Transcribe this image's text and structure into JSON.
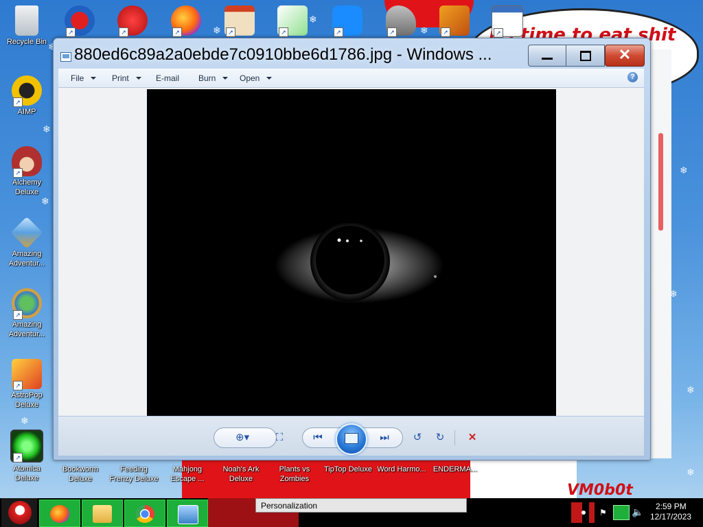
{
  "desktop": {
    "left_icons": [
      {
        "label": "Recycle Bin",
        "icon": "recycle-bin-icon",
        "color": "#d8dde4"
      },
      {
        "label": "AIMP",
        "icon": "aimp-icon",
        "color": "#f2c200"
      },
      {
        "label": "Alchemy Deluxe",
        "icon": "wizard-icon",
        "color": "#b03030"
      },
      {
        "label": "Amazing Adventur...",
        "icon": "gem-icon",
        "color": "#5aa0e0"
      },
      {
        "label": "Amazing Adventur...",
        "icon": "globe-icon",
        "color": "#3a9a3a"
      },
      {
        "label": "AstroPop Deluxe",
        "icon": "astropop-icon",
        "color": "#e04020"
      },
      {
        "label": "Atomica Deluxe",
        "icon": "radiation-icon",
        "color": "#20c020"
      }
    ],
    "bottom_icons": [
      {
        "label": "Bookworm Deluxe"
      },
      {
        "label": "Feeding Frenzy Deluxe"
      },
      {
        "label": "Mahjong Escape ..."
      },
      {
        "label": "Noah's Ark Deluxe"
      },
      {
        "label": "Plants vs Zombies"
      },
      {
        "label": "TipTop Deluxe"
      },
      {
        "label": "Word Harmo..."
      },
      {
        "label": "ENDERMA..."
      }
    ],
    "wallpaper_text": {
      "top": "its time to eat shit",
      "bottom": "VM0b0t"
    }
  },
  "window": {
    "title": "880ed6c89a2a0ebde7c0910bbe6d1786.jpg - Windows ...",
    "menu": [
      {
        "label": "File",
        "has_dropdown": true
      },
      {
        "label": "Print",
        "has_dropdown": true
      },
      {
        "label": "E-mail",
        "has_dropdown": false
      },
      {
        "label": "Burn",
        "has_dropdown": true
      },
      {
        "label": "Open",
        "has_dropdown": true
      }
    ],
    "help_glyph": "?",
    "close_glyph": "✕"
  },
  "controls": {
    "zoom": "zoom-icon",
    "actual_size": "actual-size-icon",
    "previous": "previous-icon",
    "slideshow": "slideshow-icon",
    "next": "next-icon",
    "rotate_ccw": "rotate-counterclockwise-icon",
    "rotate_cw": "rotate-clockwise-icon",
    "delete": "delete-icon"
  },
  "taskbar": {
    "tooltip": "Personalization",
    "time": "2:59 PM",
    "date": "12/17/2023",
    "button_color": "#1eae3a"
  }
}
